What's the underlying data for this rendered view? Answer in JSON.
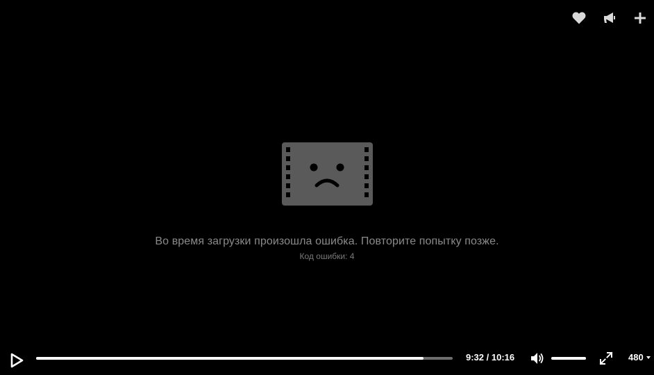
{
  "top_actions": [
    {
      "name": "like",
      "icon": "heart-icon"
    },
    {
      "name": "share",
      "icon": "megaphone-icon"
    },
    {
      "name": "add",
      "icon": "plus-icon"
    }
  ],
  "error": {
    "icon": "sad-film-icon",
    "message": "Во время загрузки произошла ошибка. Повторите попытку позже.",
    "code": "Код ошибки: 4"
  },
  "controls": {
    "play_icon": "play-icon",
    "progress": 0.93,
    "time": "9:32 / 10:16",
    "volume_icon": "volume-icon",
    "volume_level": 1.0,
    "fullscreen_icon": "fullscreen-icon",
    "quality": "480"
  },
  "colors": {
    "background": "#000000",
    "icon_gray": "#5a5a5a",
    "text_gray": "#8a8a8a",
    "progress_track": "#6e6e6e",
    "progress_fill": "#ffffff"
  }
}
